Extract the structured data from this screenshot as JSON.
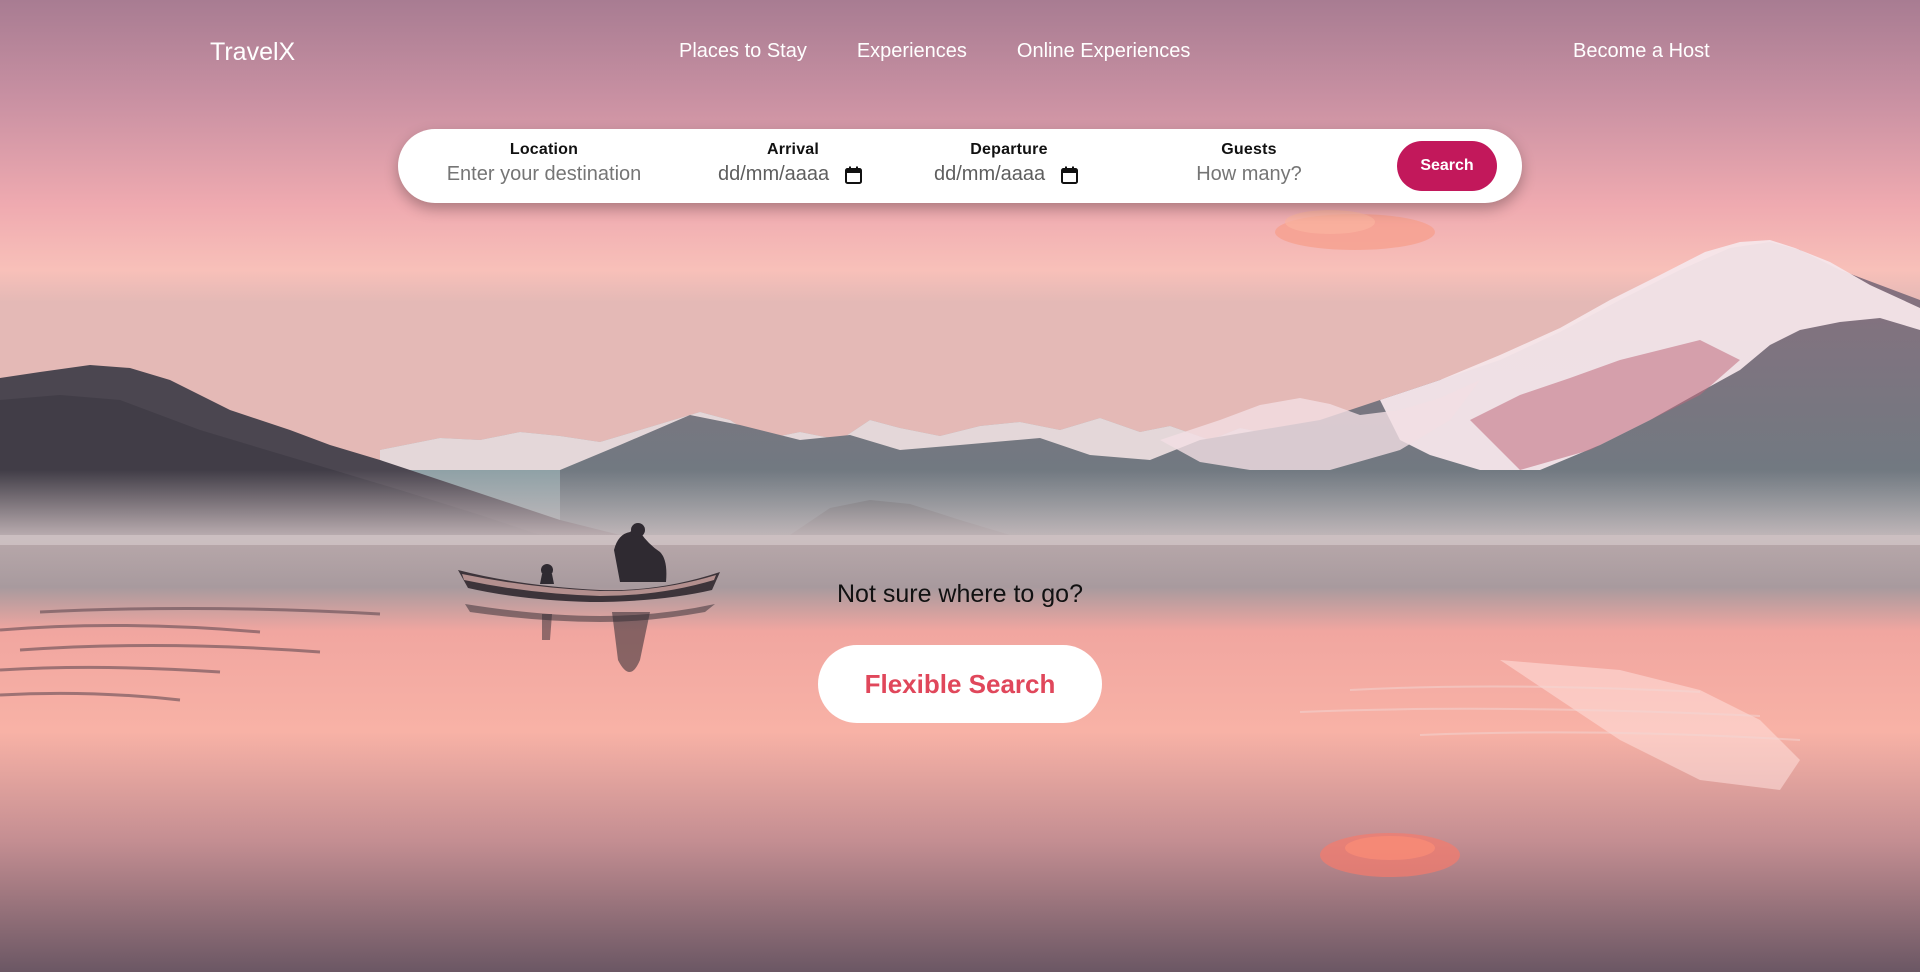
{
  "header": {
    "logo": "TravelX",
    "nav": [
      "Places to Stay",
      "Experiences",
      "Online Experiences"
    ],
    "host_link": "Become a Host"
  },
  "search": {
    "location": {
      "label": "Location",
      "placeholder": "Enter your destination"
    },
    "arrival": {
      "label": "Arrival",
      "placeholder": "dd/mm/aaaa"
    },
    "departure": {
      "label": "Departure",
      "placeholder": "dd/mm/aaaa"
    },
    "guests": {
      "label": "Guests",
      "placeholder": "How many?"
    },
    "button_label": "Search"
  },
  "hero": {
    "prompt": "Not sure where to go?",
    "button_label": "Flexible Search"
  },
  "colors": {
    "accent": "#c2185b",
    "flexible_text": "#e0475b",
    "sky_top": "#a87c92",
    "sky_bottom": "#f5b5ad"
  },
  "icons": [
    "calendar-icon"
  ]
}
